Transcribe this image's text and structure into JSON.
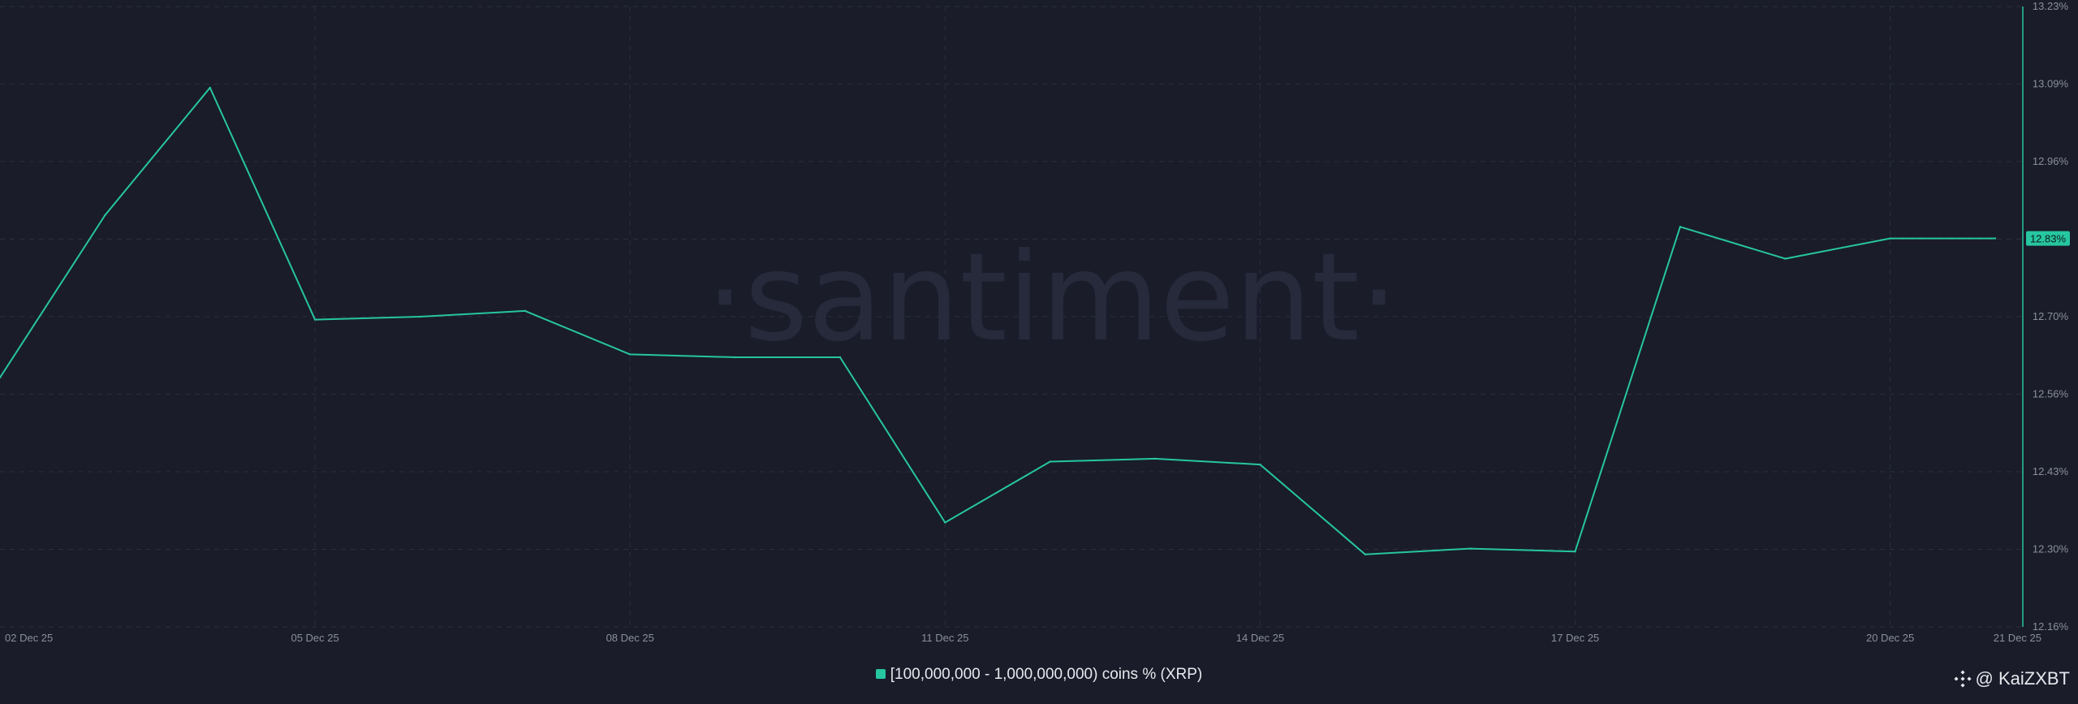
{
  "chart_data": {
    "type": "line",
    "title": "",
    "xlabel": "",
    "ylabel": "",
    "x": [
      "2025-12-02",
      "2025-12-03",
      "2025-12-04",
      "2025-12-05",
      "2025-12-06",
      "2025-12-07",
      "2025-12-08",
      "2025-12-09",
      "2025-12-10",
      "2025-12-11",
      "2025-12-12",
      "2025-12-13",
      "2025-12-14",
      "2025-12-15",
      "2025-12-16",
      "2025-12-17",
      "2025-12-18",
      "2025-12-19",
      "2025-12-20",
      "2025-12-21"
    ],
    "series": [
      {
        "name": "[100,000,000 - 1,000,000,000) coins % (XRP)",
        "color": "#26c6a0",
        "values": [
          12.59,
          12.87,
          13.09,
          12.69,
          12.695,
          12.705,
          12.63,
          12.625,
          12.625,
          12.34,
          12.445,
          12.45,
          12.44,
          12.285,
          12.295,
          12.29,
          12.85,
          12.795,
          12.83,
          12.83
        ]
      }
    ],
    "xticks": [
      {
        "date": "2025-12-02",
        "label": "02 Dec 25"
      },
      {
        "date": "2025-12-05",
        "label": "05 Dec 25"
      },
      {
        "date": "2025-12-08",
        "label": "08 Dec 25"
      },
      {
        "date": "2025-12-11",
        "label": "11 Dec 25"
      },
      {
        "date": "2025-12-14",
        "label": "14 Dec 25"
      },
      {
        "date": "2025-12-17",
        "label": "17 Dec 25"
      },
      {
        "date": "2025-12-20",
        "label": "20 Dec 25"
      },
      {
        "date": "2025-12-21",
        "label": "21 Dec 25"
      }
    ],
    "yticks": [
      "13.23%",
      "13.09%",
      "12.96%",
      "12.83%",
      "12.70%",
      "12.56%",
      "12.43%",
      "12.30%",
      "12.16%"
    ],
    "ylim": [
      12.16,
      13.23
    ],
    "y_axis_side": "right",
    "grid": true,
    "last_value_badge": "12.83%",
    "watermark": "·santiment·",
    "legend_position": "bottom-center"
  },
  "legend": {
    "label": "[100,000,000 - 1,000,000,000) coins % (XRP)"
  },
  "credit": {
    "text": "@ KaiZXBT",
    "icon": "binance-logo-icon"
  },
  "colors": {
    "background": "#1a1c2a",
    "line": "#26c6a0",
    "grid": "#2b2e3f",
    "axis_text": "#8b8e9c"
  }
}
